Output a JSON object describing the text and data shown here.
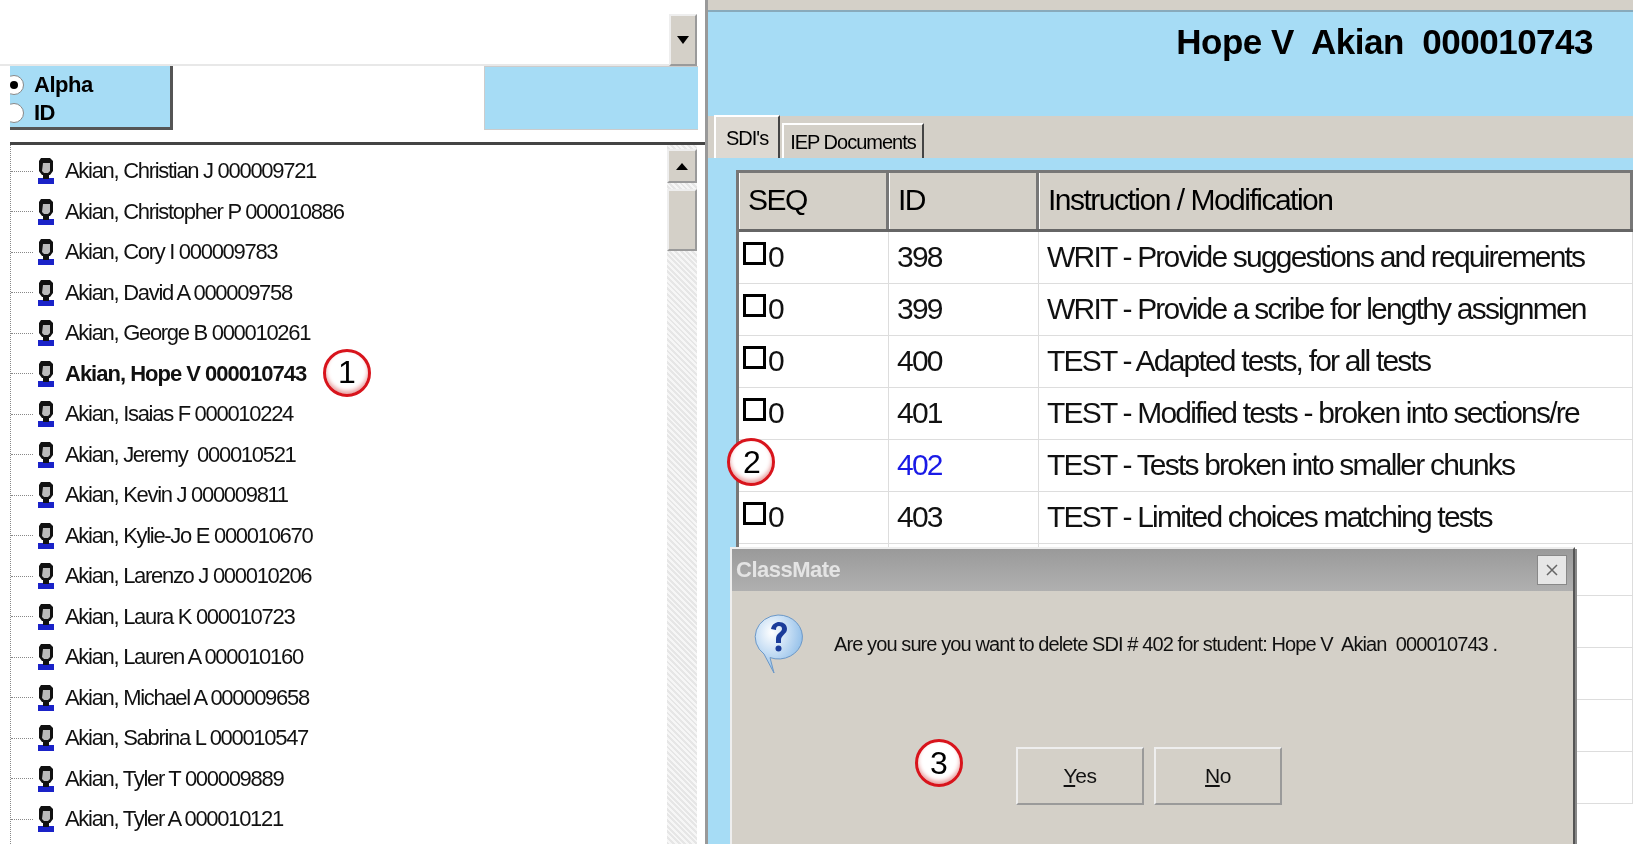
{
  "sort_options": [
    {
      "label": "Alpha",
      "selected": true
    },
    {
      "label": "ID",
      "selected": false
    }
  ],
  "students": [
    {
      "name": "Akian, Christian J 000009721",
      "selected": false
    },
    {
      "name": "Akian, Christopher P 000010886",
      "selected": false
    },
    {
      "name": "Akian, Cory I 000009783",
      "selected": false
    },
    {
      "name": "Akian, David A 000009758",
      "selected": false
    },
    {
      "name": "Akian, George B 000010261",
      "selected": false
    },
    {
      "name": "Akian, Hope V 000010743",
      "selected": true
    },
    {
      "name": "Akian, Isaias F 000010224",
      "selected": false
    },
    {
      "name": "Akian, Jeremy  000010521",
      "selected": false
    },
    {
      "name": "Akian, Kevin J 000009811",
      "selected": false
    },
    {
      "name": "Akian, Kylie-Jo E 000010670",
      "selected": false
    },
    {
      "name": "Akian, Larenzo J 000010206",
      "selected": false
    },
    {
      "name": "Akian, Laura K 000010723",
      "selected": false
    },
    {
      "name": "Akian, Lauren A 000010160",
      "selected": false
    },
    {
      "name": "Akian, Michael A 000009658",
      "selected": false
    },
    {
      "name": "Akian, Sabrina L 000010547",
      "selected": false
    },
    {
      "name": "Akian, Tyler T 000009889",
      "selected": false
    },
    {
      "name": "Akian, Tyler A 000010121",
      "selected": false
    }
  ],
  "student_header": {
    "title": "Hope V  Akian  000010743"
  },
  "tabs": [
    {
      "label": "SDI's",
      "selected": true
    },
    {
      "label": "IEP Documents",
      "selected": false
    }
  ],
  "table": {
    "columns": [
      "SEQ",
      "ID",
      "Instruction / Modification"
    ],
    "rows": [
      {
        "seq": "0",
        "checked": false,
        "id": "398",
        "instruction": "WRIT - Provide suggestions and requirements",
        "selected": false
      },
      {
        "seq": "0",
        "checked": false,
        "id": "399",
        "instruction": "WRIT - Provide a scribe for lengthy assignmen",
        "selected": false
      },
      {
        "seq": "0",
        "checked": false,
        "id": "400",
        "instruction": "TEST - Adapted tests, for all tests",
        "selected": false
      },
      {
        "seq": "0",
        "checked": false,
        "id": "401",
        "instruction": "TEST - Modified tests - broken into sections/re",
        "selected": false
      },
      {
        "id": "402",
        "instruction": "TEST - Tests broken into smaller chunks",
        "selected": true
      },
      {
        "seq": "0",
        "checked": false,
        "id": "403",
        "instruction": "TEST - Limited choices matching tests",
        "selected": false
      }
    ]
  },
  "dialog": {
    "title": "ClassMate",
    "message": "Are you sure you want to delete SDI # 402 for student: Hope V  Akian  000010743 .",
    "buttons": [
      "Yes",
      "No"
    ]
  },
  "annotations": [
    "1",
    "2",
    "3"
  ]
}
